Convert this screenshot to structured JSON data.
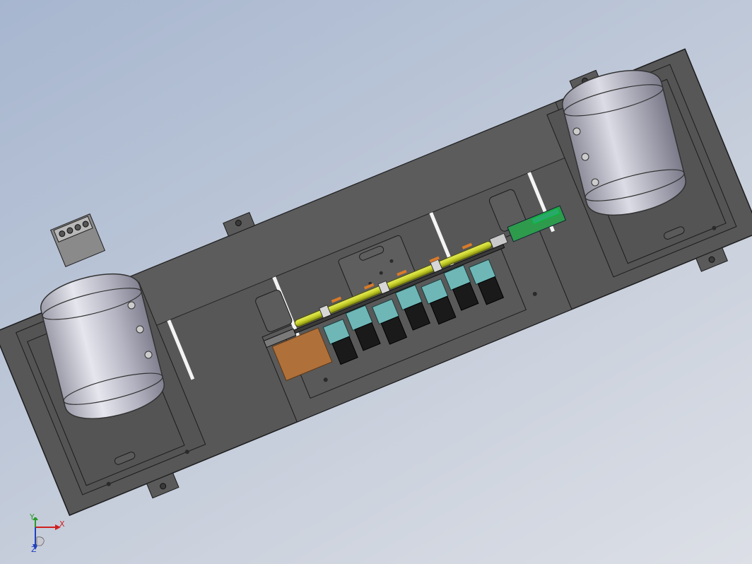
{
  "viewport": {
    "background_top": "#a7b6cf",
    "background_bottom": "#dcdfe6"
  },
  "model": {
    "plate_color": "#565656",
    "edge_color": "#1e1e1e",
    "tank_color": "#c3c3cd",
    "shaft_color": "#c8d22a",
    "valve_color": "#6fb7b7",
    "motor_color": "#1a1a1a",
    "pcb_color": "#2e9a4c",
    "copper_color": "#b0703a",
    "tank_count": 2,
    "valve_count": 7
  },
  "triad": {
    "x_label": "X",
    "y_label": "Y",
    "z_label": "Z",
    "x_color": "#d02020",
    "y_color": "#2a9a2a",
    "z_color": "#2040c0"
  }
}
